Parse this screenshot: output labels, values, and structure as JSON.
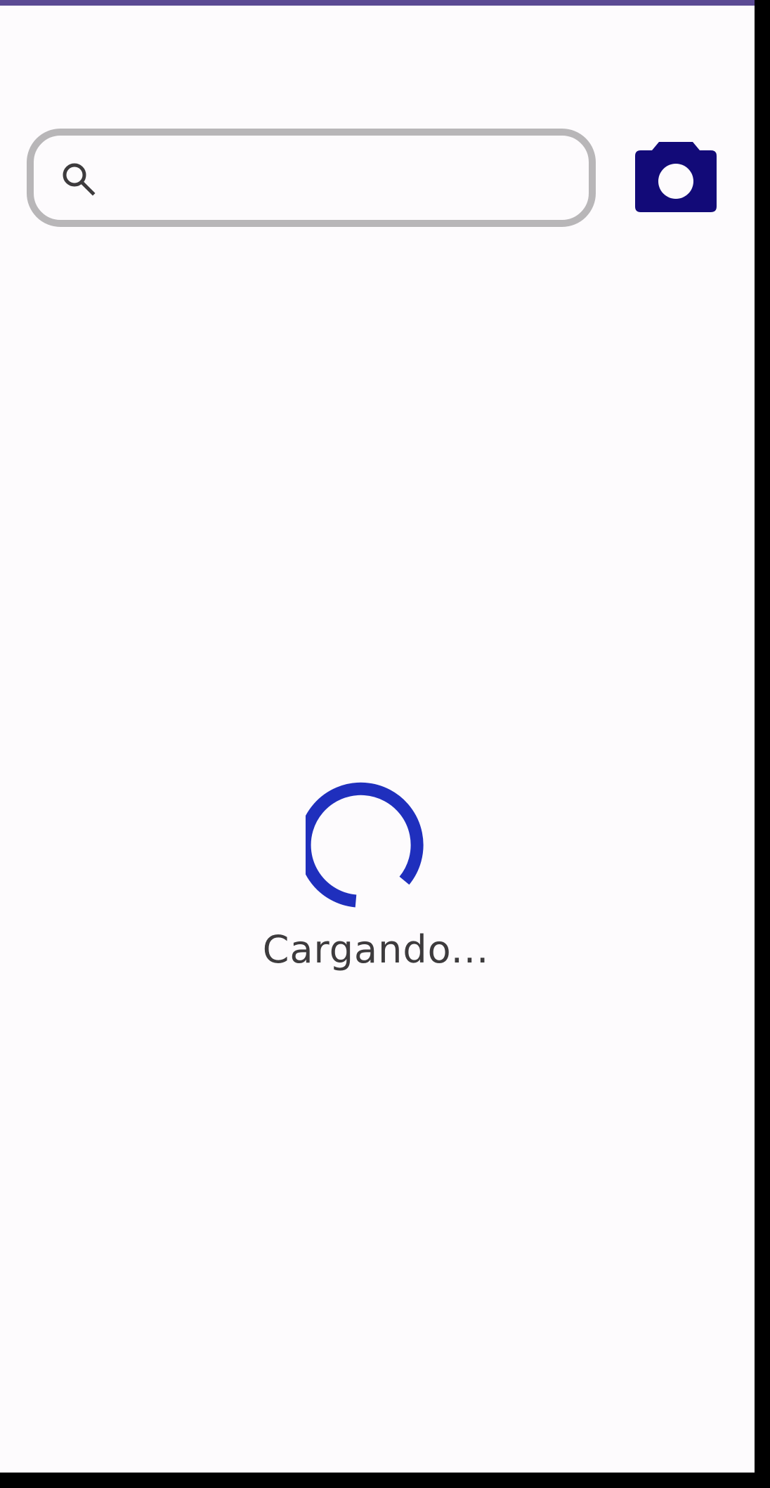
{
  "search": {
    "value": "",
    "placeholder": "",
    "icon": "search-icon"
  },
  "camera": {
    "icon": "camera-icon"
  },
  "loading": {
    "text": "Cargando..."
  },
  "colors": {
    "status_strip": "#5b4a94",
    "screen_background": "#fdfbfd",
    "search_border": "#b8b6b8",
    "camera": "#120a78",
    "spinner": "#1f2fbd",
    "text": "#3d3b3d"
  }
}
